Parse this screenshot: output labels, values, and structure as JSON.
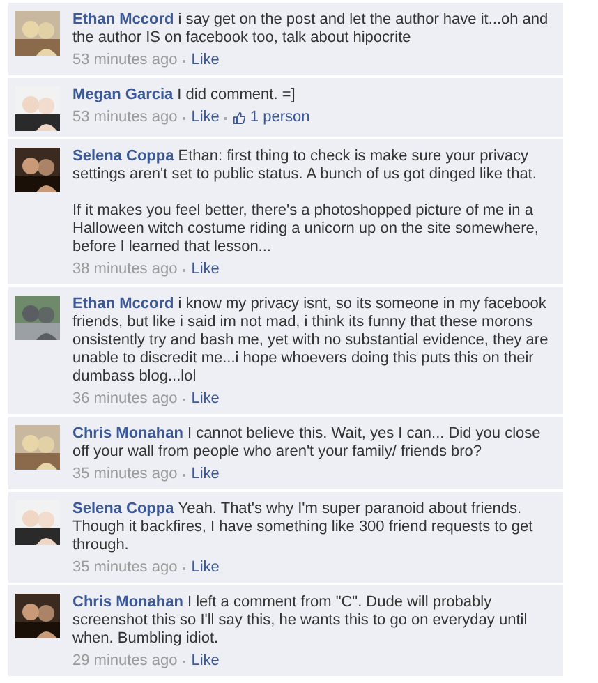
{
  "comments": [
    {
      "author": "Ethan Mccord",
      "paragraphs": [
        "i say get on the post and let the author have it...oh and the author IS on facebook too, talk about hipocrite"
      ],
      "time": "53 minutes ago",
      "like": "Like"
    },
    {
      "author": "Megan Garcia",
      "paragraphs": [
        "I did comment. =]"
      ],
      "time": "53 minutes ago",
      "like": "Like",
      "likers": "1 person"
    },
    {
      "author": "Selena Coppa",
      "paragraphs": [
        "Ethan: first thing to check is make sure your privacy settings aren't set to public status. A bunch of us got dinged like that.",
        "If it makes you feel better, there's a photoshopped picture of me in a Halloween witch costume riding a unicorn up on the site somewhere, before I learned that lesson..."
      ],
      "time": "38 minutes ago",
      "like": "Like"
    },
    {
      "author": "Ethan Mccord",
      "paragraphs": [
        "i know my privacy isnt, so its someone in my facebook friends, but like i said im not mad, i think its funny that these morons onsistently try and bash me, yet with no substantial evidence, they are unable to discredit me...i hope whoevers doing this puts this on their dumbass blog...lol"
      ],
      "time": "36 minutes ago",
      "like": "Like"
    },
    {
      "author": "Chris Monahan",
      "paragraphs": [
        "I cannot believe this. Wait, yes I can... Did you close off your wall from people who aren't your family/ friends bro?"
      ],
      "time": "35 minutes ago",
      "like": "Like"
    },
    {
      "author": "Selena Coppa",
      "paragraphs": [
        "Yeah. That's why I'm super paranoid about friends. Though it backfires, I have something like 300 friend requests to get through."
      ],
      "time": "35 minutes ago",
      "like": "Like"
    },
    {
      "author": "Chris Monahan",
      "paragraphs": [
        "I left a comment from \"C\". Dude will probably screenshot this so I'll say this, he wants this to go on everyday until when. Bumbling idiot."
      ],
      "time": "29 minutes ago",
      "like": "Like"
    }
  ]
}
